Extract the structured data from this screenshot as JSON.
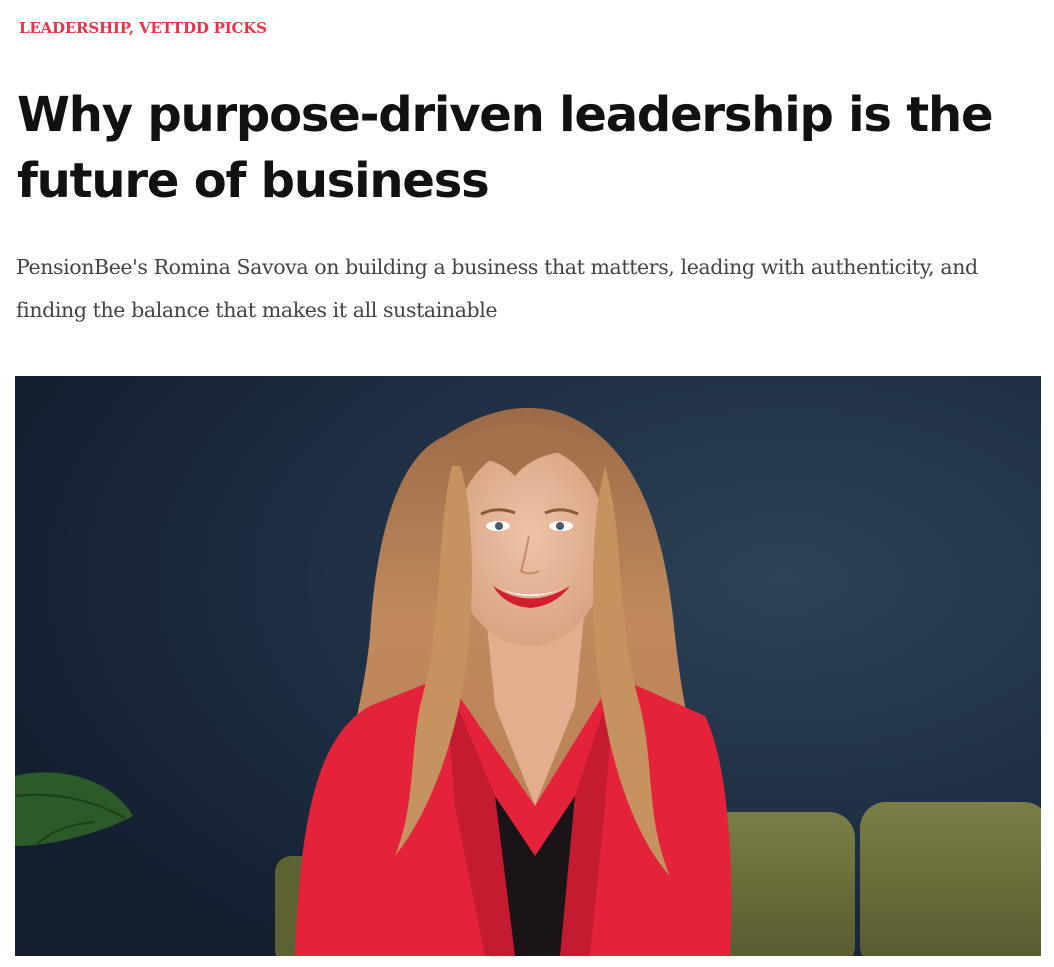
{
  "article": {
    "categories": [
      {
        "label": "LEADERSHIP"
      },
      {
        "label": "VETTDD PICKS"
      }
    ],
    "category_separator": ", ",
    "title": "Why purpose-driven leadership is the future of business",
    "subtitle": "PensionBee's Romina Savova on building a business that matters, leading with authenticity, and finding the balance that makes it all sustainable",
    "hero_image": {
      "icon": "portrait-photo"
    }
  },
  "colors": {
    "category": "#e8334a",
    "title": "#111111",
    "subtitle": "#444444",
    "wall": "#1c2a3c",
    "jacket": "#e4233a",
    "sofa": "#6a6e3c",
    "hair": "#b98256"
  }
}
